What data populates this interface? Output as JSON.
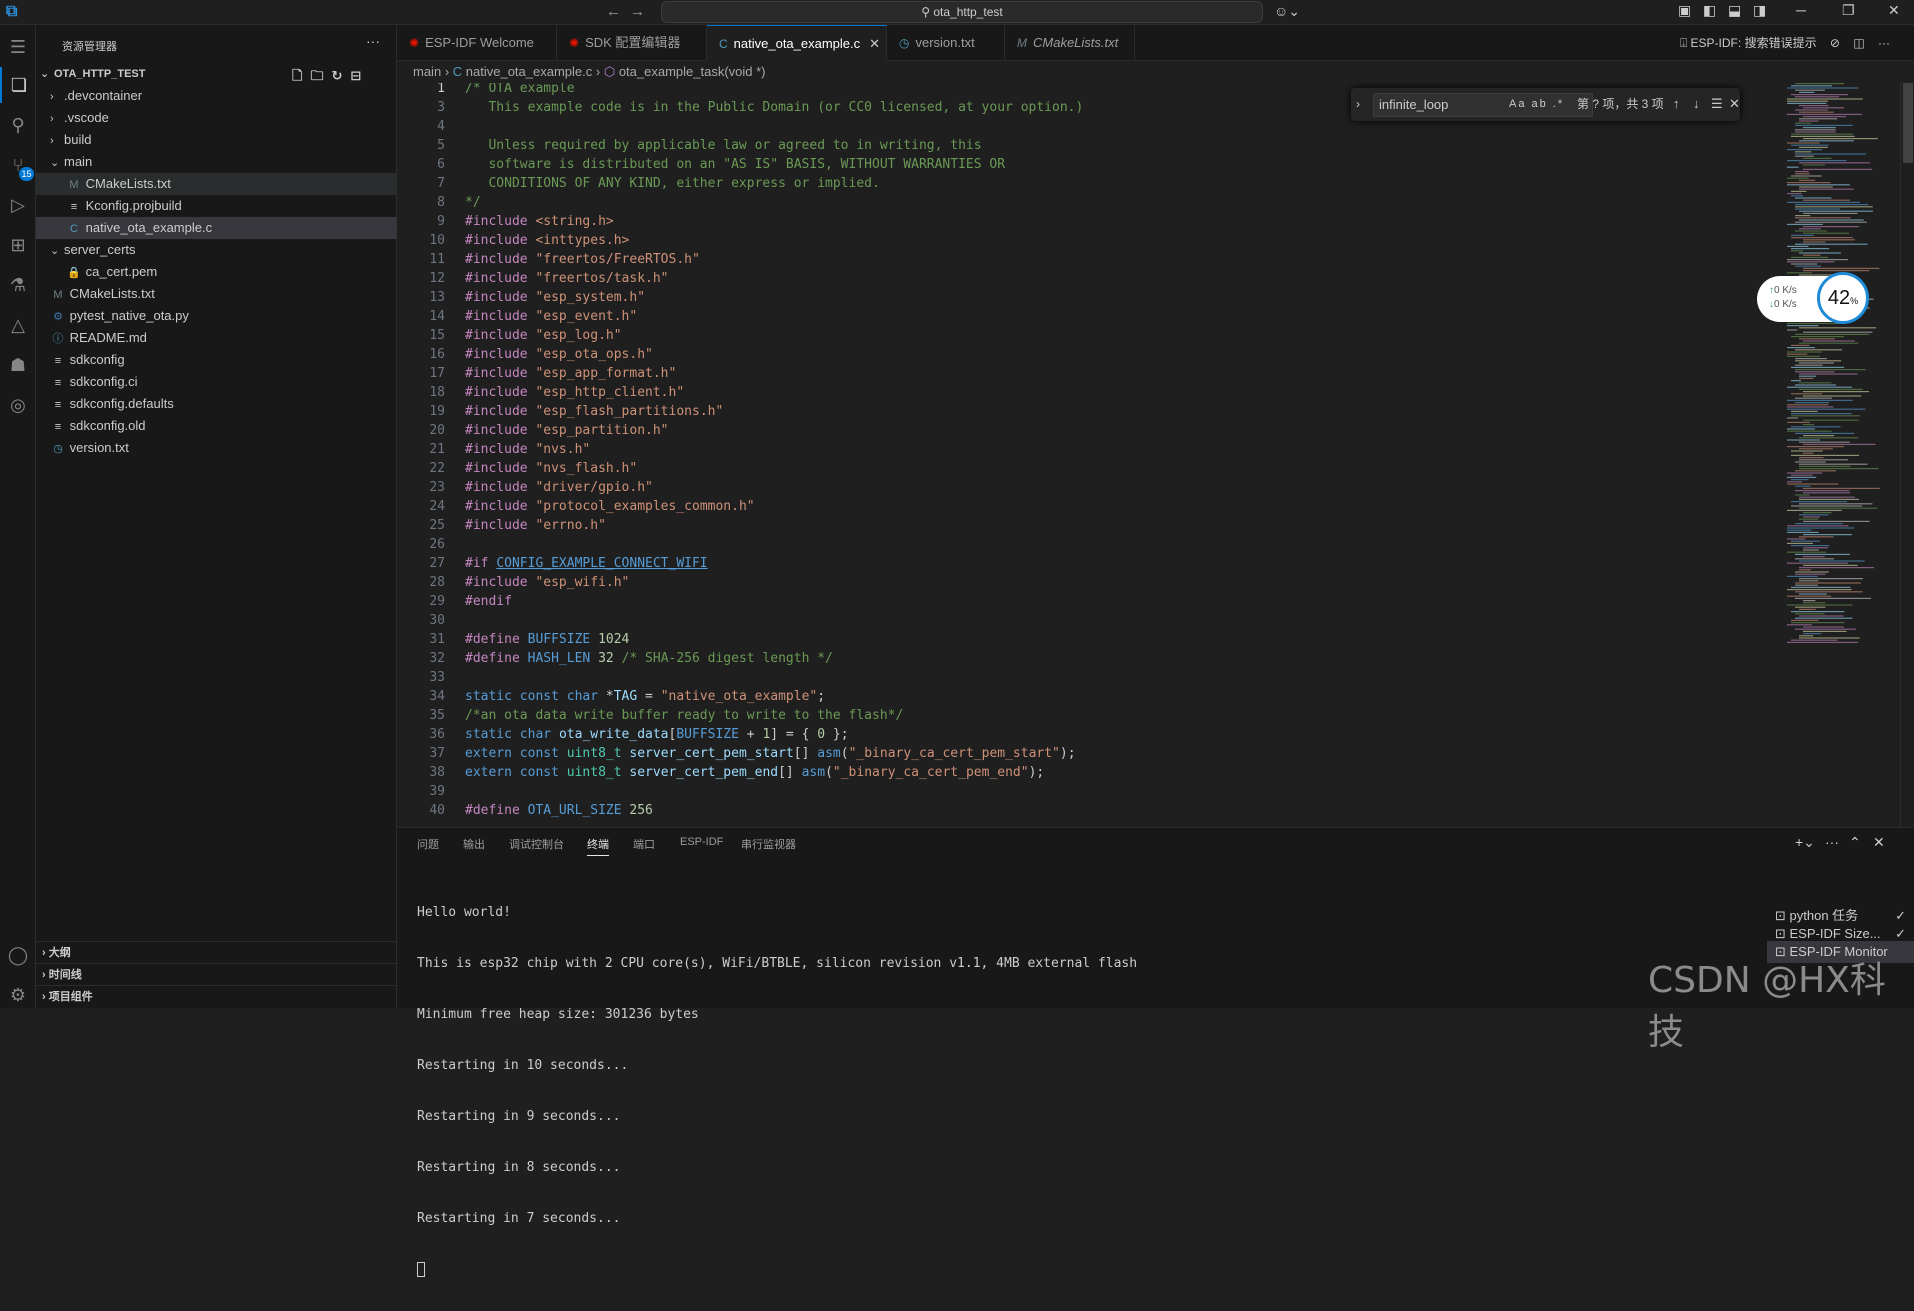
{
  "titlebar": {
    "search": "ota_http_test",
    "back": "←",
    "forward": "→"
  },
  "activitybar": {
    "badge": "15"
  },
  "explorer": {
    "title": "资源管理器",
    "more": "···",
    "root": "OTA_HTTP_TEST",
    "items": [
      {
        "label": ".devcontainer"
      },
      {
        "label": ".vscode"
      },
      {
        "label": "build"
      },
      {
        "label": "main"
      },
      {
        "label": "CMakeLists.txt"
      },
      {
        "label": "Kconfig.projbuild"
      },
      {
        "label": "native_ota_example.c"
      },
      {
        "label": "server_certs"
      },
      {
        "label": "ca_cert.pem"
      },
      {
        "label": "CMakeLists.txt"
      },
      {
        "label": "pytest_native_ota.py"
      },
      {
        "label": "README.md"
      },
      {
        "label": "sdkconfig"
      },
      {
        "label": "sdkconfig.ci"
      },
      {
        "label": "sdkconfig.defaults"
      },
      {
        "label": "sdkconfig.old"
      },
      {
        "label": "version.txt"
      }
    ],
    "sections": [
      "大纲",
      "时间线",
      "项目组件"
    ]
  },
  "tabs": [
    {
      "label": "ESP-IDF Welcome"
    },
    {
      "label": "SDK 配置编辑器"
    },
    {
      "label": "native_ota_example.c"
    },
    {
      "label": "version.txt"
    },
    {
      "label": "CMakeLists.txt"
    }
  ],
  "editor_tools": {
    "esp_idf": "ESP-IDF:",
    "search_hint": "搜索错误提示"
  },
  "breadcrumb": {
    "folder": "main",
    "file": "native_ota_example.c",
    "symbol": "ota_example_task(void *)"
  },
  "find": {
    "query": "infinite_loop",
    "options": "Aa ab .*",
    "count": "第 ? 项，共 3 项"
  },
  "code": {
    "line_numbers": [
      "1",
      "3",
      "4",
      "5",
      "6",
      "7",
      "8",
      "9",
      "10",
      "11",
      "12",
      "13",
      "14",
      "15",
      "16",
      "17",
      "18",
      "19",
      "20",
      "21",
      "22",
      "23",
      "24",
      "25",
      "26",
      "27",
      "28",
      "29",
      "30",
      "31",
      "32",
      "33",
      "34",
      "35",
      "36",
      "37",
      "38",
      "39",
      "40"
    ]
  },
  "network": {
    "up": "0   K/s",
    "down": "0   K/s",
    "percent": "42",
    "percent_unit": "%"
  },
  "panel": {
    "tabs": [
      "问题",
      "输出",
      "调试控制台",
      "终端",
      "端口",
      "ESP-IDF",
      "串行监视器"
    ],
    "terminal_lines": [
      "Hello world!",
      "This is esp32 chip with 2 CPU core(s), WiFi/BTBLE, silicon revision v1.1, 4MB external flash",
      "Minimum free heap size: 301236 bytes",
      "Restarting in 10 seconds...",
      "Restarting in 9 seconds...",
      "Restarting in 8 seconds...",
      "Restarting in 7 seconds..."
    ],
    "terminals": [
      "python 任务",
      "ESP-IDF Size...",
      "ESP-IDF Monitor"
    ]
  },
  "watermark": "CSDN @HX科技",
  "colors": {
    "accent": "#0078d4",
    "comment": "#6a9955",
    "keyword": "#569cd6",
    "string": "#ce9178",
    "preprocessor": "#c586c0"
  }
}
